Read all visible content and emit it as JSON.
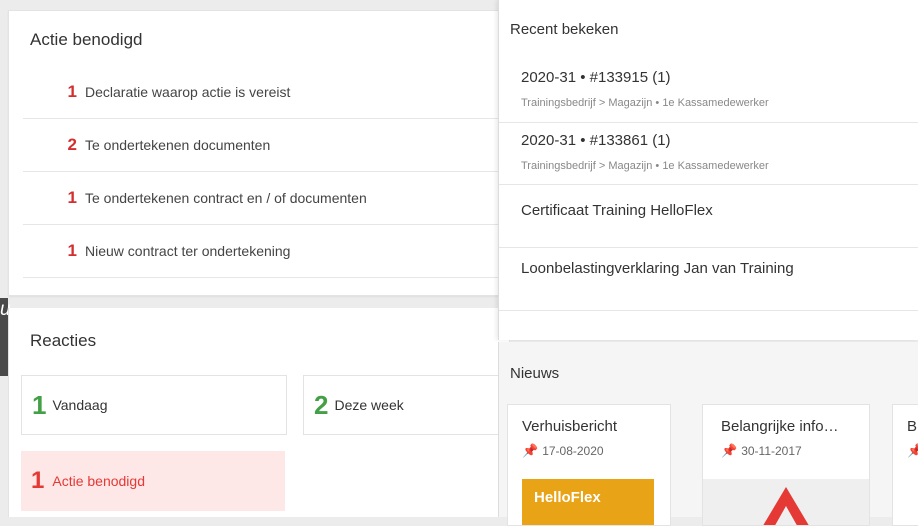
{
  "actie": {
    "title": "Actie benodigd",
    "items": [
      {
        "count": "1",
        "label": "Declaratie waarop actie is vereist"
      },
      {
        "count": "2",
        "label": "Te ondertekenen documenten"
      },
      {
        "count": "1",
        "label": "Te ondertekenen contract en / of documenten"
      },
      {
        "count": "1",
        "label": "Nieuw contract ter ondertekening"
      }
    ]
  },
  "reacties": {
    "title": "Reacties",
    "boxes": [
      {
        "count": "1",
        "label": "Vandaag",
        "color": "#43a047"
      },
      {
        "count": "2",
        "label": "Deze week",
        "color": "#43a047"
      },
      {
        "count": "1",
        "label": "Actie benodigd",
        "color": "#e53935"
      }
    ]
  },
  "recent": {
    "title": "Recent bekeken",
    "items": [
      {
        "title": "2020-31 • #133915 (1)",
        "subtitle": "Trainingsbedrijf > Magazijn • 1e Kassamedewerker"
      },
      {
        "title": "2020-31 • #133861 (1)",
        "subtitle": "Trainingsbedrijf > Magazijn • 1e Kassamedewerker"
      },
      {
        "title": "Certificaat Training HelloFlex",
        "subtitle": ""
      },
      {
        "title": "Loonbelastingverklaring Jan van Training",
        "subtitle": ""
      }
    ]
  },
  "nieuws": {
    "title": "Nieuws",
    "cards": [
      {
        "title": "Verhuisbericht",
        "date": "17-08-2020",
        "image_text": "HelloFlex"
      },
      {
        "title": "Belangrijke info…",
        "date": "30-11-2017"
      },
      {
        "title": "B",
        "date": ""
      }
    ]
  },
  "colors": {
    "red": "#d32f2f",
    "green": "#43a047",
    "pin": "#f5a623",
    "brand_orange": "#e8a317"
  }
}
